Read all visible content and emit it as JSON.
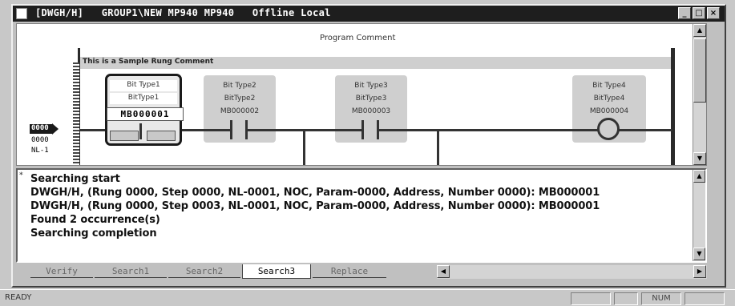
{
  "window": {
    "title": "[DWGH/H]   GROUP1\\NEW MP940 MP940   Offline Local",
    "minimize_glyph": "_",
    "maximize_glyph": "□",
    "close_glyph": "×"
  },
  "ladder": {
    "program_comment": "Program Comment",
    "rung_comment": "This is a Sample Rung Comment",
    "left_labels": [
      "0000",
      "0000",
      "NL-1"
    ],
    "contacts": [
      {
        "line1": "Bit Type1",
        "line2": "BitType1",
        "address": "MB000001",
        "selected": true
      },
      {
        "line1": "Bit Type2",
        "line2": "BitType2",
        "address": "MB000002",
        "selected": false
      },
      {
        "line1": "Bit Type3",
        "line2": "BitType3",
        "address": "MB000003",
        "selected": false
      }
    ],
    "coil": {
      "line1": "Bit Type4",
      "line2": "BitType4",
      "address": "MB000004"
    }
  },
  "output": {
    "lines": [
      "Searching start",
      "DWGH/H, (Rung 0000, Step 0000, NL-0001, NOC, Param-0000, Address, Number 0000): MB000001",
      "DWGH/H, (Rung 0000, Step 0003, NL-0001, NOC, Param-0000, Address, Number 0000): MB000001",
      "Found 2 occurrence(s)",
      "Searching completion"
    ],
    "tabs": [
      {
        "label": "Verify",
        "active": false
      },
      {
        "label": "Search1",
        "active": false
      },
      {
        "label": "Search2",
        "active": false
      },
      {
        "label": "Search3",
        "active": true
      },
      {
        "label": "Replace",
        "active": false
      }
    ]
  },
  "statusbar": {
    "ready": "READY",
    "num": "NUM"
  }
}
